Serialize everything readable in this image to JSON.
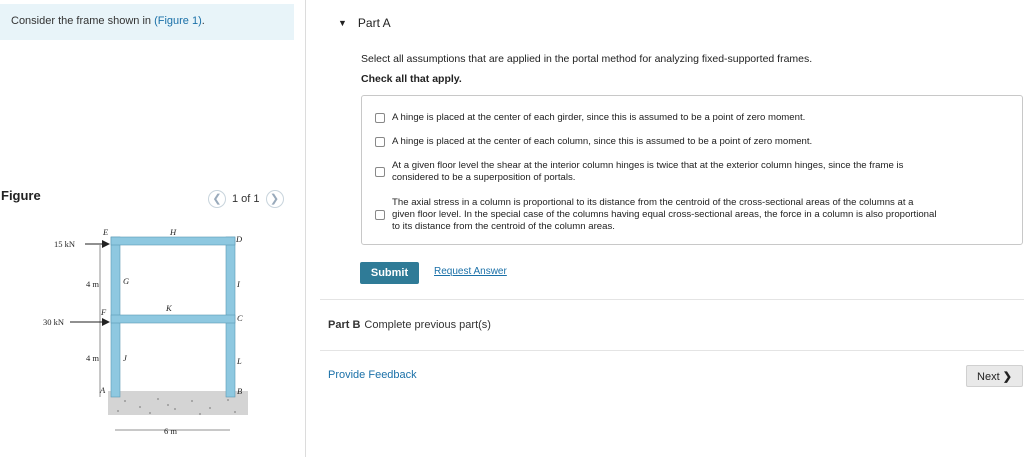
{
  "intro": {
    "text": "Consider the frame shown in ",
    "link": "(Figure 1)",
    "end": "."
  },
  "figure": {
    "title": "Figure",
    "pager": "1 of 1",
    "prev_icon": "chevron-left-icon",
    "next_icon": "chevron-right-icon",
    "labels": {
      "load_top": "15 kN",
      "load_mid": "30 kN",
      "height_top": "4 m",
      "height_bottom": "4 m",
      "width": "6 m",
      "E": "E",
      "H": "H",
      "D": "D",
      "G": "G",
      "I": "I",
      "F": "F",
      "K": "K",
      "C": "C",
      "J": "J",
      "L": "L",
      "A": "A",
      "B": "B"
    }
  },
  "part_a": {
    "toggle_icon": "collapse-triangle-icon",
    "title": "Part A",
    "prompt": "Select all assumptions that are applied in the portal method for analyzing fixed-supported frames.",
    "instruction": "Check all that apply.",
    "options": [
      {
        "line1": "A hinge is placed at the center of each girder, since this is assumed to be a point of zero moment.",
        "line2": "",
        "line3": "",
        "checked": false
      },
      {
        "line1": "A hinge is placed at the center of each column, since this is assumed to be a point of zero moment.",
        "line2": "",
        "line3": "",
        "checked": false
      },
      {
        "line1": "At a given floor level the shear at the interior column hinges is twice that at the exterior column hinges, since the frame is",
        "line2": "considered to be a superposition of portals.",
        "line3": "",
        "checked": false
      },
      {
        "line1": "The axial stress in a column is proportional to its distance from the centroid of the cross-sectional areas of the columns at a",
        "line2": "given floor level. In the special case of the columns having equal cross-sectional areas, the force in a column is also proportional",
        "line3": "to its distance from the centroid of the column areas.",
        "checked": false
      }
    ],
    "submit_label": "Submit",
    "request_label": "Request Answer"
  },
  "part_b": {
    "title": "Part B",
    "status": "Complete previous part(s)"
  },
  "footer": {
    "feedback_label": "Provide Feedback",
    "next_label": "Next",
    "next_icon": "chevron-right-icon"
  },
  "colors": {
    "intro_bg": "#e8f4f9",
    "submit_bg": "#2f7b97",
    "link": "#1a70a8",
    "frame_member": "#8ec8e0"
  }
}
